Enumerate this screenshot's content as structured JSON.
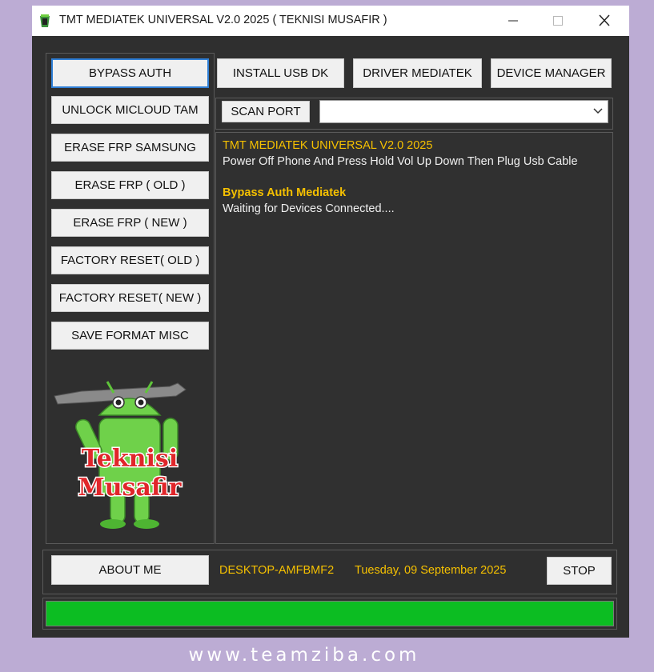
{
  "window": {
    "title": "TMT MEDIATEK UNIVERSAL V2.0 2025 ( TEKNISI MUSAFIR )",
    "icon": "android-app-icon"
  },
  "left_menu": [
    {
      "label": "BYPASS AUTH",
      "selected": true
    },
    {
      "label": "UNLOCK MICLOUD TAM"
    },
    {
      "label": "ERASE FRP SAMSUNG"
    },
    {
      "label": "ERASE FRP ( OLD )"
    },
    {
      "label": "ERASE FRP ( NEW )"
    },
    {
      "label": "FACTORY RESET( OLD )"
    },
    {
      "label": "FACTORY RESET( NEW )"
    },
    {
      "label": "SAVE FORMAT MISC"
    }
  ],
  "toolbar": {
    "install_usb_dk": "INSTALL USB DK",
    "driver_mediatek": "DRIVER MEDIATEK",
    "device_manager": "DEVICE MANAGER"
  },
  "port": {
    "scan_label": "SCAN PORT",
    "selected": ""
  },
  "log": {
    "line1": "TMT MEDIATEK UNIVERSAL V2.0 2025",
    "line2": "Power Off Phone And Press Hold Vol Up Down Then Plug Usb Cable",
    "line3": "Bypass Auth Mediatek",
    "line4": "Waiting for Devices Connected...."
  },
  "mascot": {
    "text1": "Teknisi",
    "text2": "Musafir"
  },
  "footer": {
    "about_label": "ABOUT ME",
    "computer_name": "DESKTOP-AMFBMF2",
    "date": "Tuesday, 09 September 2025",
    "stop_label": "STOP"
  },
  "progress": {
    "fraction": 1.0,
    "color": "#0cbd22"
  },
  "watermark": "www.teamziba.com",
  "colors": {
    "window_bg": "#2f2f2f",
    "accent_text": "#f5c000",
    "selected_border": "#2f7fd6",
    "page_bg": "#bcacd4"
  }
}
